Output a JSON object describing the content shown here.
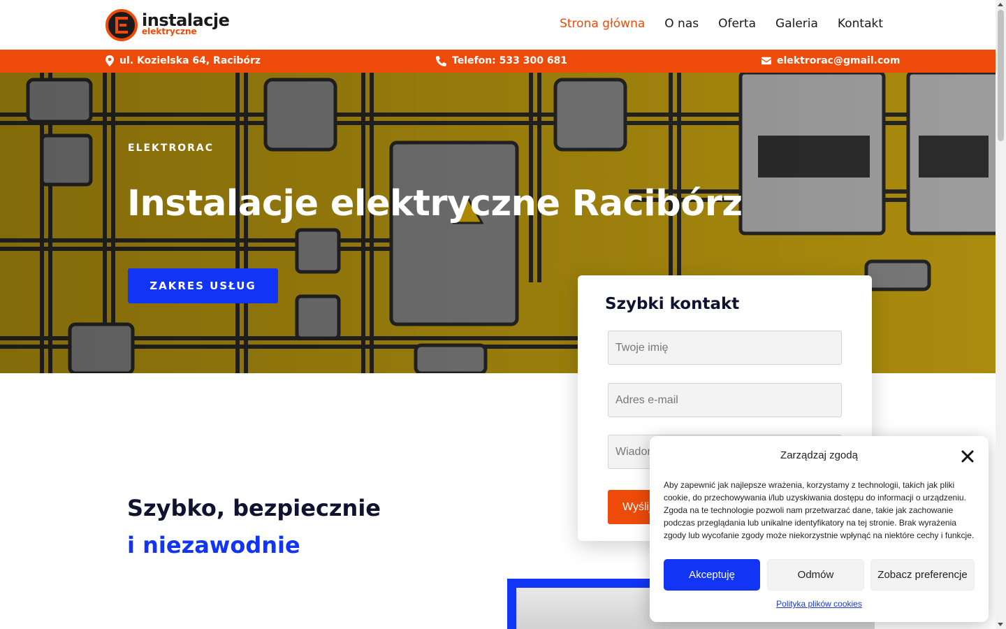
{
  "logo": {
    "main": "instalacje",
    "sub": "elektryczne"
  },
  "nav": [
    {
      "label": "Strona główna",
      "active": true
    },
    {
      "label": "O nas",
      "active": false
    },
    {
      "label": "Oferta",
      "active": false
    },
    {
      "label": "Galeria",
      "active": false
    },
    {
      "label": "Kontakt",
      "active": false
    }
  ],
  "infobar": {
    "address": "ul. Kozielska 64, Racibórz",
    "phone": "Telefon: 533 300 681",
    "email": "elektrorac@gmail.com"
  },
  "hero": {
    "eyebrow": "ELEKTRORAC",
    "title": "Instalacje elektryczne Racibórz",
    "button": "ZAKRES USŁUG"
  },
  "quick_contact": {
    "title": "Szybki kontakt",
    "name_placeholder": "Twoje imię",
    "email_placeholder": "Adres e-mail",
    "message_placeholder": "Wiadomość",
    "send_label": "Wyślij"
  },
  "section": {
    "line1": "Szybko, bezpiecznie",
    "line2": "i niezawodnie"
  },
  "cookie": {
    "title": "Zarządzaj zgodą",
    "text": "Aby zapewnić jak najlepsze wrażenia, korzystamy z technologii, takich jak pliki cookie, do przechowywania i/lub uzyskiwania dostępu do informacji o urządzeniu. Zgoda na te technologie pozwoli nam przetwarzać dane, takie jak zachowanie podczas przeglądania lub unikalne identyfikatory na tej stronie. Brak wyrażenia zgody lub wycofanie zgody może niekorzystnie wpłynąć na niektóre cechy i funkcje.",
    "accept": "Akceptuję",
    "deny": "Odmów",
    "prefs": "Zobacz preferencje",
    "policy_link": "Polityka plików cookies"
  },
  "colors": {
    "accent_orange": "#ee4b0a",
    "accent_blue": "#1235f5",
    "navy": "#0f1330",
    "hero_yellow": "#c9a410"
  }
}
